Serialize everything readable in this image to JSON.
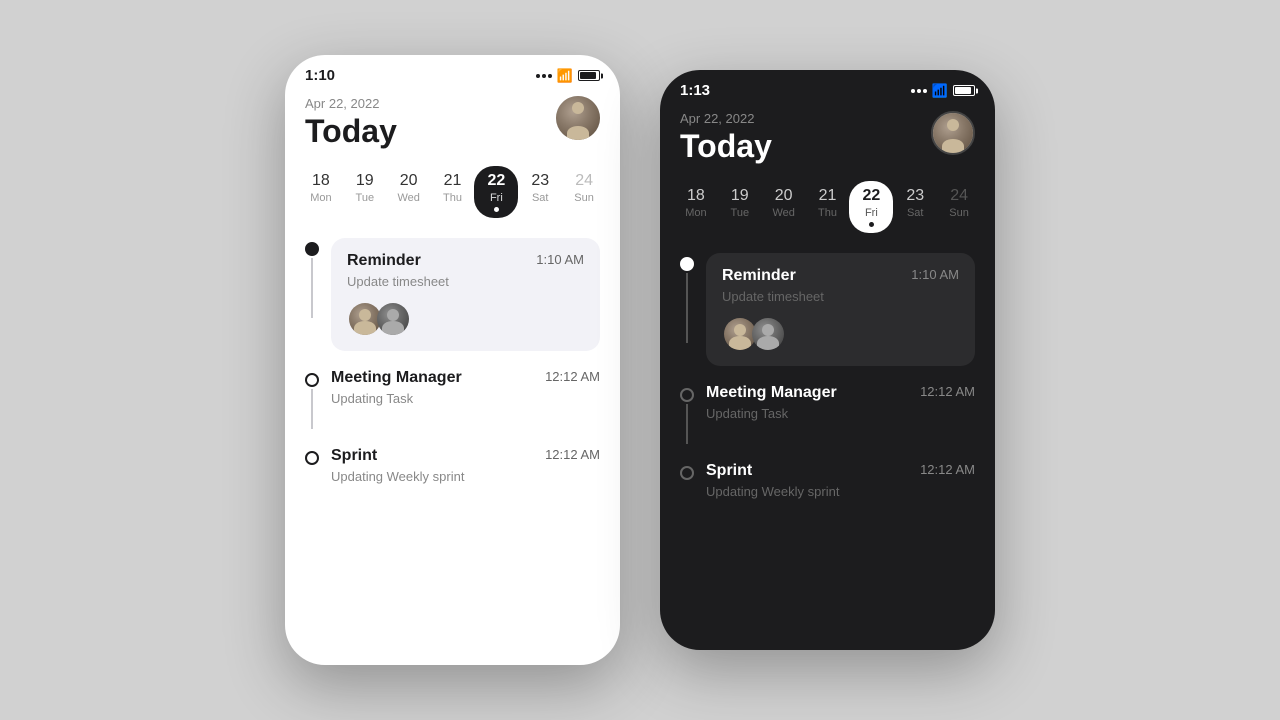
{
  "light_phone": {
    "status_time": "1:10",
    "date": "Apr 22, 2022",
    "today": "Today",
    "calendar": [
      {
        "num": "18",
        "day": "Mon"
      },
      {
        "num": "19",
        "day": "Tue"
      },
      {
        "num": "20",
        "day": "Wed"
      },
      {
        "num": "21",
        "day": "Thu"
      },
      {
        "num": "22",
        "day": "Fri",
        "selected": true,
        "dot": true
      },
      {
        "num": "23",
        "day": "Sat"
      },
      {
        "num": "24",
        "day": "Sun"
      }
    ],
    "events": [
      {
        "title": "Reminder",
        "time": "1:10 AM",
        "subtitle": "Update timesheet",
        "has_card": true,
        "has_avatars": true,
        "marker": "filled"
      },
      {
        "title": "Meeting Manager",
        "time": "12:12 AM",
        "subtitle": "Updating Task",
        "has_card": false,
        "marker": "outline"
      },
      {
        "title": "Sprint",
        "time": "12:12 AM",
        "subtitle": "Updating Weekly sprint",
        "has_card": false,
        "marker": "outline"
      }
    ]
  },
  "dark_phone": {
    "status_time": "1:13",
    "date": "Apr 22, 2022",
    "today": "Today",
    "calendar": [
      {
        "num": "18",
        "day": "Mon"
      },
      {
        "num": "19",
        "day": "Tue"
      },
      {
        "num": "20",
        "day": "Wed"
      },
      {
        "num": "21",
        "day": "Thu"
      },
      {
        "num": "22",
        "day": "Fri",
        "selected": true,
        "dot": true
      },
      {
        "num": "23",
        "day": "Sat"
      },
      {
        "num": "24",
        "day": "Sun"
      }
    ],
    "events": [
      {
        "title": "Reminder",
        "time": "1:10 AM",
        "subtitle": "Update timesheet",
        "has_card": true,
        "has_avatars": true,
        "marker": "filled"
      },
      {
        "title": "Meeting Manager",
        "time": "12:12 AM",
        "subtitle": "Updating Task",
        "has_card": false,
        "marker": "outline"
      },
      {
        "title": "Sprint",
        "time": "12:12 AM",
        "subtitle": "Updating Weekly sprint",
        "has_card": false,
        "marker": "outline"
      }
    ]
  }
}
